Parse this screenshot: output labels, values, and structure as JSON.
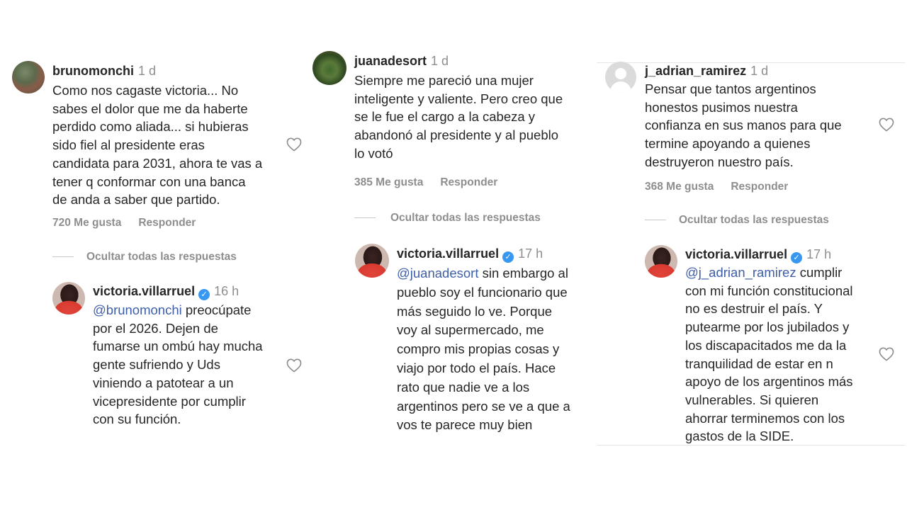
{
  "columns": [
    {
      "comment": {
        "username": "brunomonchi",
        "time": "1 d",
        "lines": [
          "Como nos cagaste victoria... No",
          "sabes el dolor que me da haberte",
          "perdido como aliada... si hubieras",
          "sido fiel al presidente eras",
          "candidata para 2031, ahora te vas a",
          "tener q conformar con una banca",
          "de anda a saber que partido."
        ],
        "likes": "720 Me gusta",
        "reply_label": "Responder"
      },
      "hide_replies": "Ocultar todas las respuestas",
      "reply": {
        "username": "victoria.villarruel",
        "time": "16 h",
        "mention": "@brunomonchi",
        "first_rest": " preocúpate",
        "lines": [
          "por el 2026. Dejen de",
          "fumarse un ombú hay mucha",
          "gente sufriendo y Uds",
          "viniendo a patotear a un",
          "vicepresidente por cumplir",
          "con su función."
        ]
      }
    },
    {
      "comment": {
        "username": "juanadesort",
        "time": "1 d",
        "lines": [
          "Siempre me pareció una mujer",
          "inteligente y valiente. Pero creo que",
          "se le fue el cargo a la cabeza y",
          "abandonó al presidente y al pueblo",
          "lo votó"
        ],
        "likes": "385 Me gusta",
        "reply_label": "Responder"
      },
      "hide_replies": "Ocultar todas las respuestas",
      "reply": {
        "username": "victoria.villarruel",
        "time": "17 h",
        "mention": "@juanadesort",
        "first_rest": " sin embargo al",
        "lines": [
          "pueblo soy el funcionario que",
          "más seguido lo ve. Porque",
          "voy al supermercado, me",
          "compro mis propias cosas y",
          "viajo por todo el país. Hace",
          "rato que nadie ve a los",
          "argentinos pero se ve a que a",
          "vos te parece muy bien"
        ]
      }
    },
    {
      "comment": {
        "username": "j_adrian_ramirez",
        "time": "1 d",
        "lines": [
          "Pensar que tantos argentinos",
          "honestos pusimos nuestra",
          "confianza en sus manos para que",
          "termine apoyando a quienes",
          "destruyeron nuestro país."
        ],
        "likes": "368 Me gusta",
        "reply_label": "Responder"
      },
      "hide_replies": "Ocultar todas las respuestas",
      "reply": {
        "username": "victoria.villarruel",
        "time": "17 h",
        "mention": "@j_adrian_ramirez",
        "first_rest": " cumplir",
        "lines": [
          "con mi función constitucional",
          "no es destruir el país. Y",
          "putearme por los jubilados y",
          "los discapacitados me da la",
          "tranquilidad de estar en n",
          "apoyo de los argentinos más",
          "vulnerables. Si quieren",
          "ahorrar terminemos con los",
          "gastos de la SIDE."
        ]
      }
    }
  ],
  "icons": {
    "like": "heart-icon",
    "verified": "verified-badge-icon",
    "avatar_placeholder": "default-avatar-icon"
  },
  "colors": {
    "text": "#262626",
    "secondary": "#8e8e8e",
    "mention": "#3e5ea8",
    "verified": "#3897f0"
  }
}
